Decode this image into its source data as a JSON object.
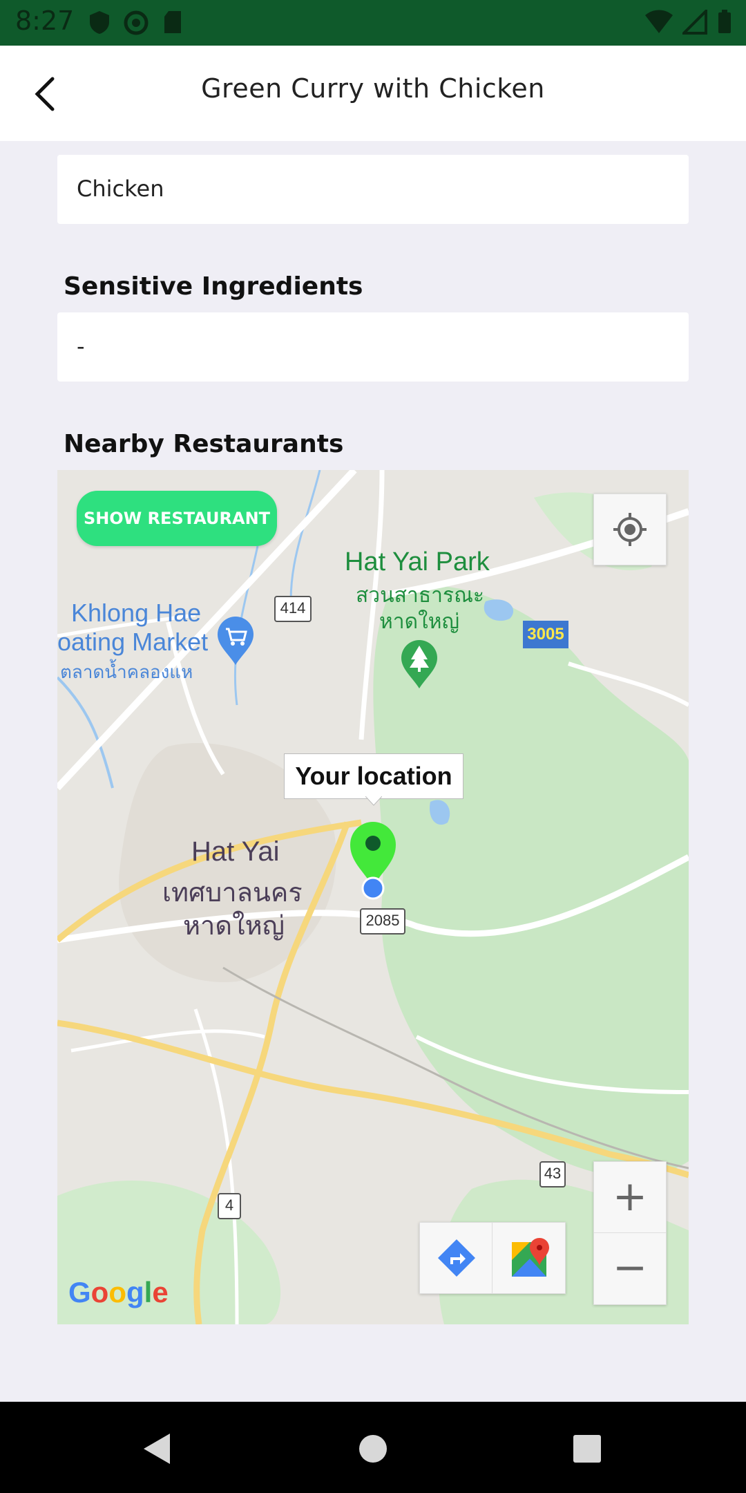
{
  "status_bar": {
    "time": "8:27"
  },
  "app_bar": {
    "title": "Green Curry with Chicken"
  },
  "form": {
    "meat_value": "Chicken",
    "sensitive_label": "Sensitive Ingredients",
    "sensitive_value": "-",
    "nearby_label": "Nearby Restaurants"
  },
  "map": {
    "show_button": "SHOW RESTAURANT",
    "callout": "Your location",
    "labels": {
      "park_en": "Hat Yai Park",
      "park_th1": "สวนสาธารณะ",
      "park_th2": "หาดใหญ่",
      "market1": "Khlong Hae",
      "market2": "oating Market",
      "market_th": "ตลาดน้ำคลองแห",
      "city_en": "Hat Yai",
      "city_th1": "เทศบาลนคร",
      "city_th2": "หาดใหญ่",
      "route_3005": "3005",
      "route_414": "414",
      "route_2085": "2085",
      "route_43": "43",
      "route_4": "4",
      "google": "Google"
    },
    "zoom_in": "+",
    "zoom_out": "−"
  },
  "colors": {
    "status_bar": "#0f5a2b",
    "accent_green": "#2ee07f",
    "marker_green": "#43e83a"
  }
}
